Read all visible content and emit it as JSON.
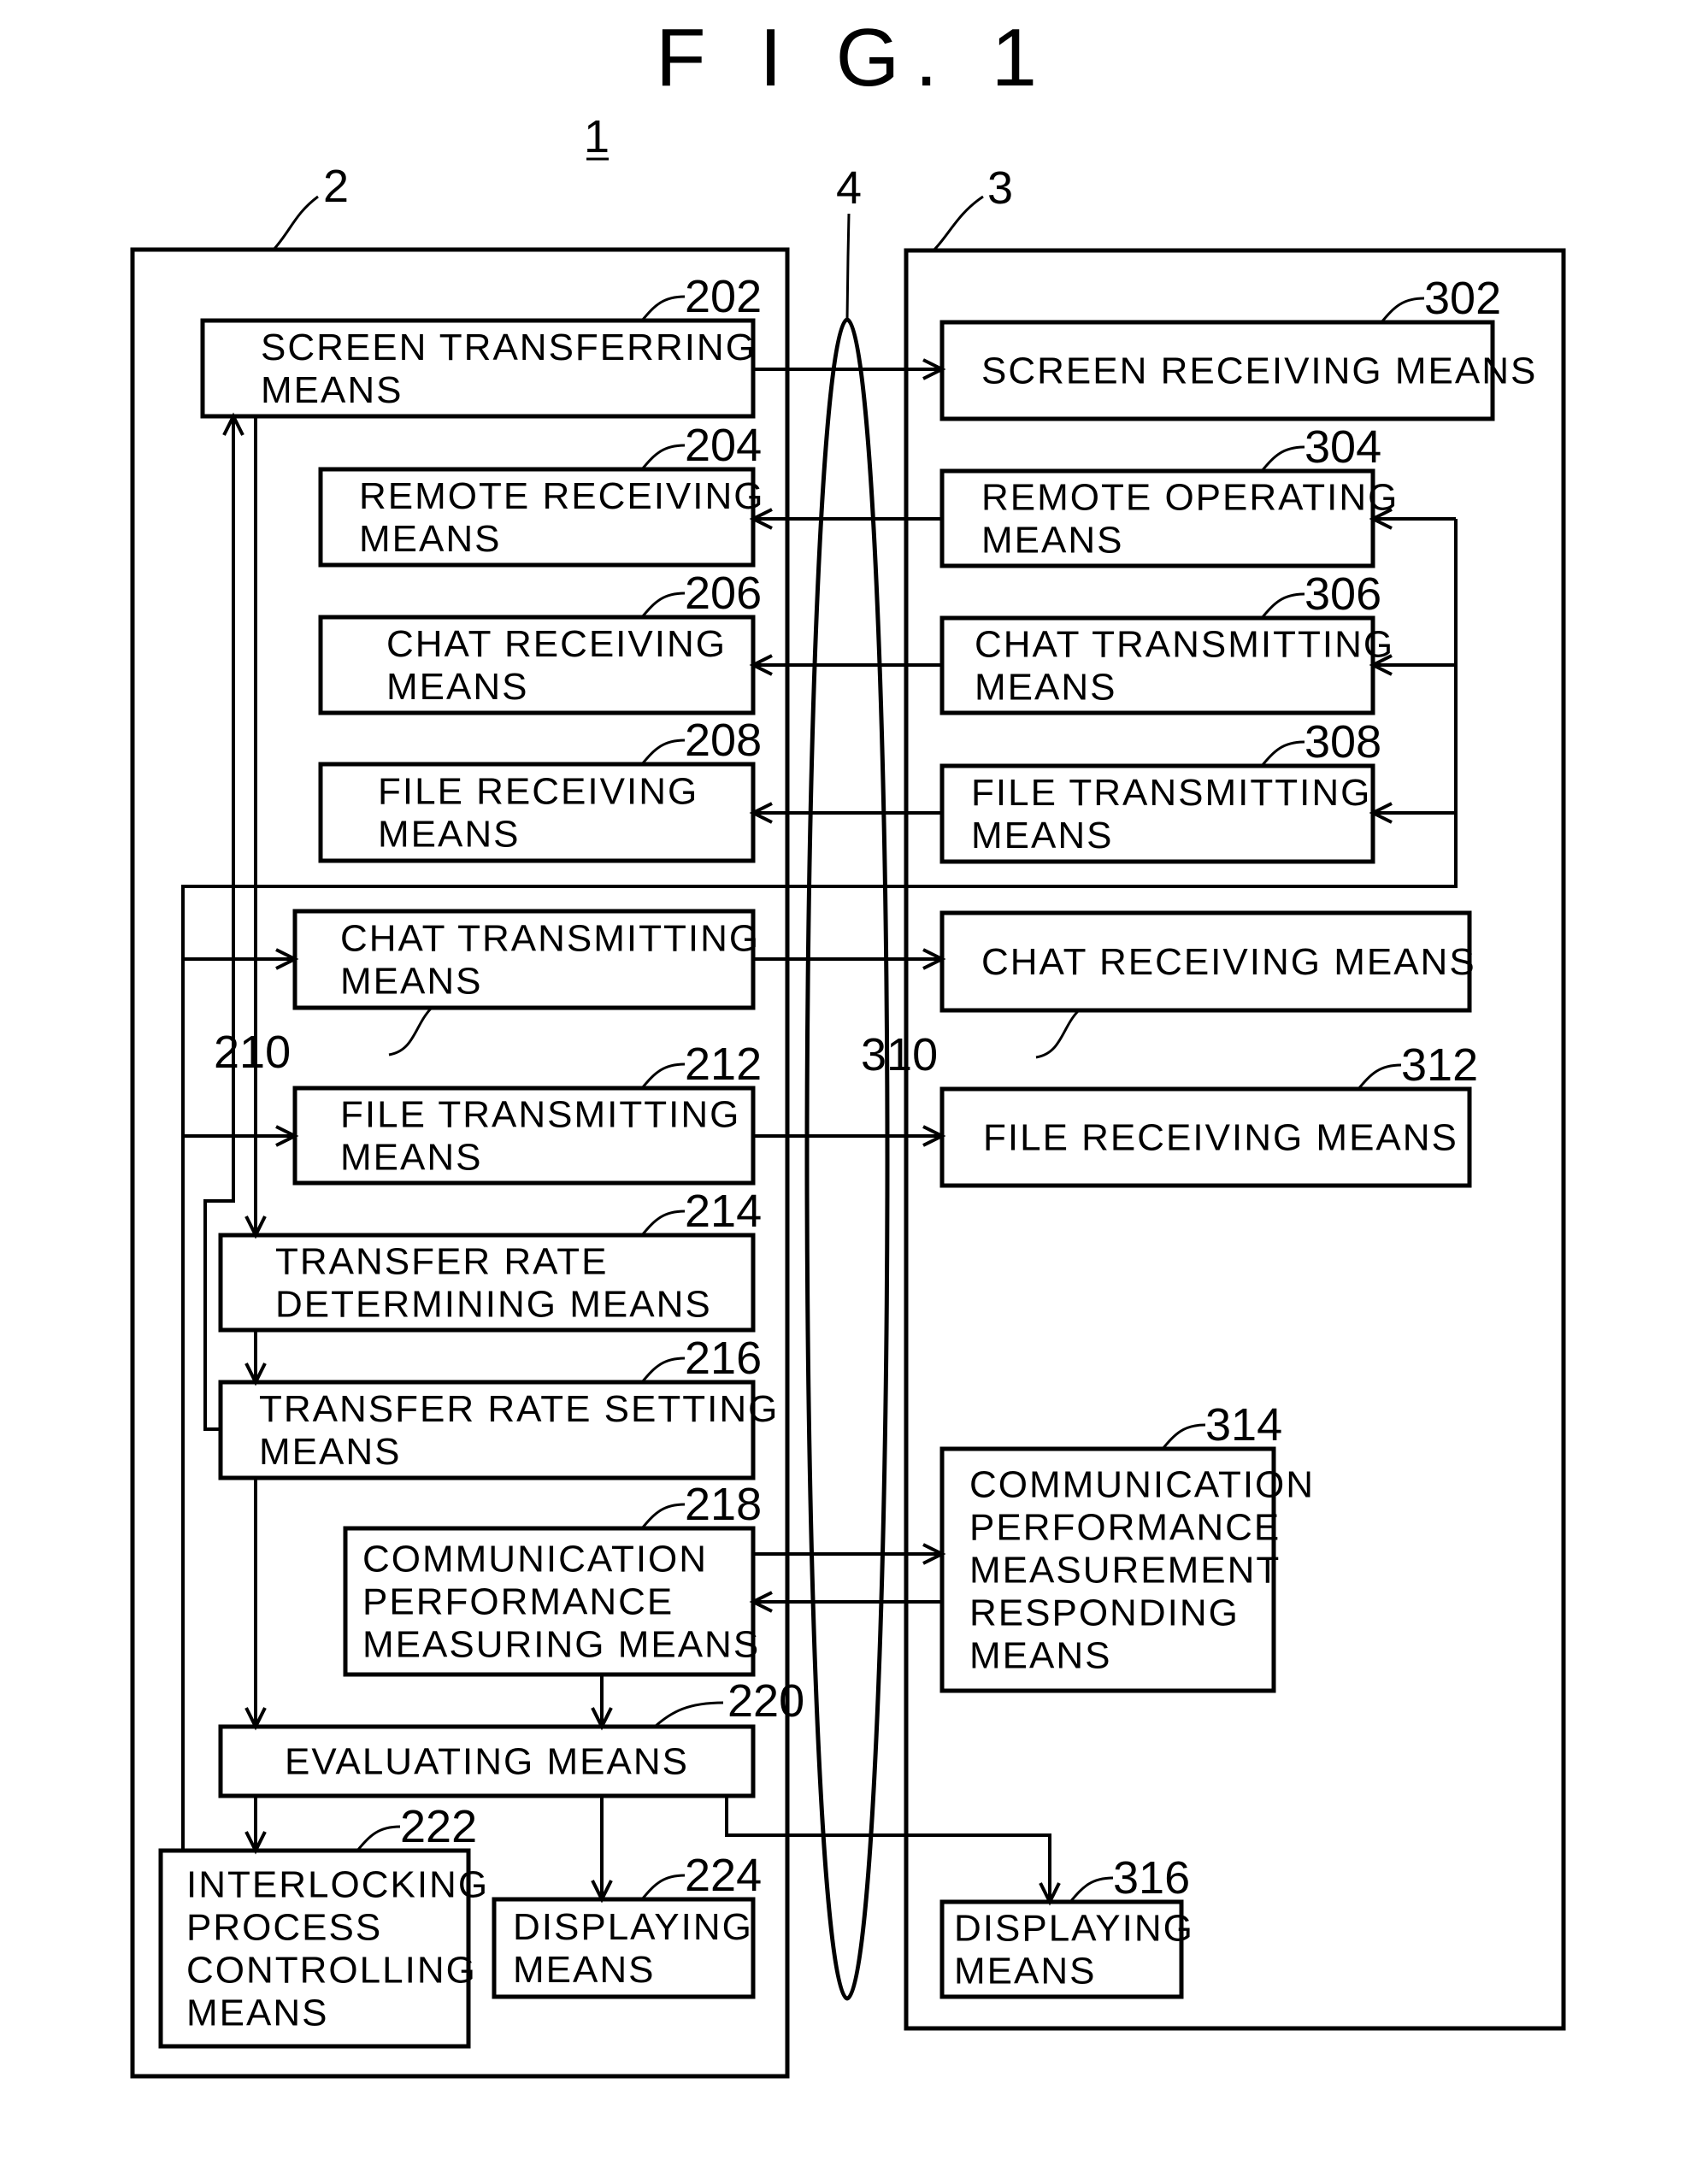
{
  "figure": {
    "title": "F I G. 1",
    "system_ref": "1",
    "left_device_ref": "2",
    "right_device_ref": "3",
    "network_ref": "4"
  },
  "left_blocks": [
    {
      "id": "202",
      "lines": [
        "SCREEN TRANSFERRING",
        "MEANS"
      ]
    },
    {
      "id": "204",
      "lines": [
        "REMOTE RECEIVING",
        "MEANS"
      ]
    },
    {
      "id": "206",
      "lines": [
        "CHAT RECEIVING",
        "MEANS"
      ]
    },
    {
      "id": "208",
      "lines": [
        "FILE RECEIVING",
        "MEANS"
      ]
    },
    {
      "id": "210",
      "lines": [
        "CHAT TRANSMITTING",
        "MEANS"
      ]
    },
    {
      "id": "212",
      "lines": [
        "FILE TRANSMITTING",
        "MEANS"
      ]
    },
    {
      "id": "214",
      "lines": [
        "TRANSFER RATE",
        "DETERMINING MEANS"
      ]
    },
    {
      "id": "216",
      "lines": [
        "TRANSFER RATE SETTING",
        "MEANS"
      ]
    },
    {
      "id": "218",
      "lines": [
        "COMMUNICATION",
        "PERFORMANCE",
        "MEASURING MEANS"
      ]
    },
    {
      "id": "220",
      "lines": [
        "EVALUATING MEANS"
      ]
    },
    {
      "id": "222",
      "lines": [
        "INTERLOCKING",
        "PROCESS",
        "CONTROLLING",
        "MEANS"
      ]
    },
    {
      "id": "224",
      "lines": [
        "DISPLAYING",
        "MEANS"
      ]
    }
  ],
  "right_blocks": [
    {
      "id": "302",
      "lines": [
        "SCREEN RECEIVING MEANS"
      ]
    },
    {
      "id": "304",
      "lines": [
        "REMOTE OPERATING",
        "MEANS"
      ]
    },
    {
      "id": "306",
      "lines": [
        "CHAT TRANSMITTING",
        "MEANS"
      ]
    },
    {
      "id": "308",
      "lines": [
        "FILE TRANSMITTING",
        "MEANS"
      ]
    },
    {
      "id": "310",
      "lines": [
        "CHAT RECEIVING MEANS"
      ]
    },
    {
      "id": "312",
      "lines": [
        "FILE RECEIVING MEANS"
      ]
    },
    {
      "id": "314",
      "lines": [
        "COMMUNICATION",
        "PERFORMANCE",
        "MEASUREMENT",
        "RESPONDING",
        "MEANS"
      ]
    },
    {
      "id": "316",
      "lines": [
        "DISPLAYING",
        "MEANS"
      ]
    }
  ]
}
